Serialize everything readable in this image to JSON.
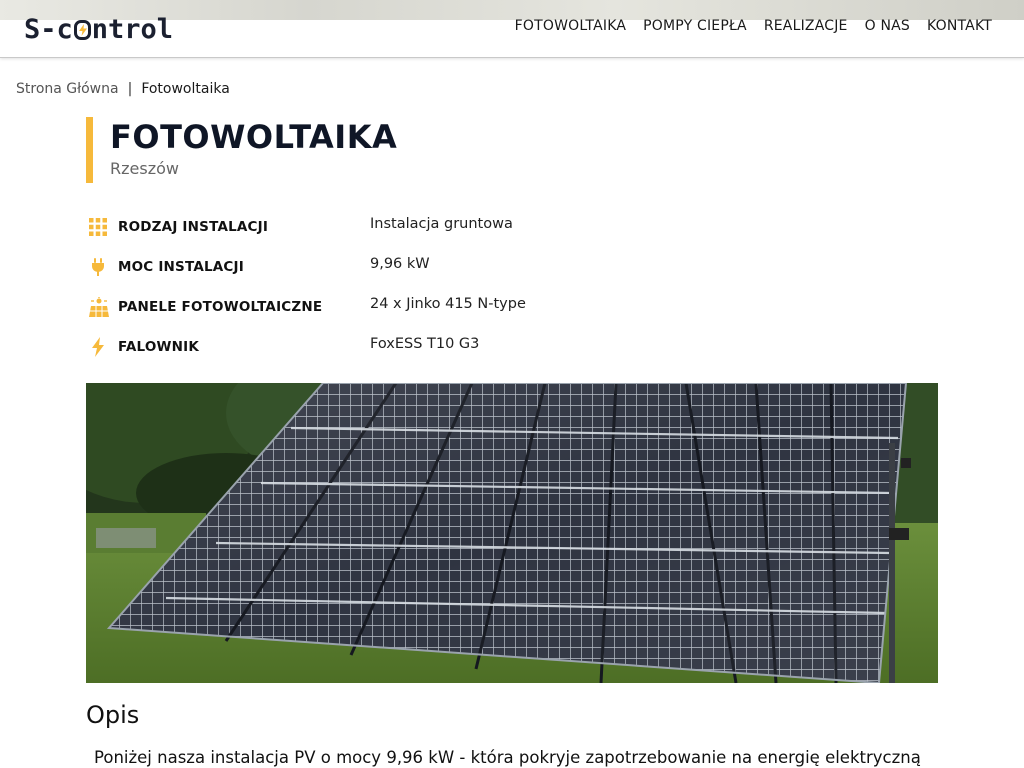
{
  "header": {
    "logo": {
      "part1": "S-c",
      "part2": "ntrol"
    },
    "nav": [
      "FOTOWOLTAIKA",
      "POMPY CIEPŁA",
      "REALIZACJE",
      "O NAS",
      "KONTAKT"
    ]
  },
  "breadcrumb": {
    "home": "Strona Główna",
    "separator": "|",
    "current": "Fotowoltaika"
  },
  "title": {
    "heading": "FOTOWOLTAIKA",
    "subtitle": "Rzeszów"
  },
  "specs": [
    {
      "icon": "grid-icon",
      "label": "RODZAJ INSTALACJI",
      "value": "Instalacja gruntowa"
    },
    {
      "icon": "plug-icon",
      "label": "MOC INSTALACJI",
      "value": "9,96 kW"
    },
    {
      "icon": "solar-panel-icon",
      "label": "PANELE FOTOWOLTAICZNE",
      "value": "24 x Jinko 415 N-type"
    },
    {
      "icon": "lightning-icon",
      "label": "FALOWNIK",
      "value": "FoxESS T10 G3"
    }
  ],
  "description": {
    "heading": "Opis",
    "text": "Poniżej nasza instalacja PV o mocy 9,96 kW - która pokryje zapotrzebowanie na energię elektryczną"
  },
  "colors": {
    "accent": "#f6b93b",
    "title": "#0f1626",
    "icon": "#f6b93b"
  }
}
